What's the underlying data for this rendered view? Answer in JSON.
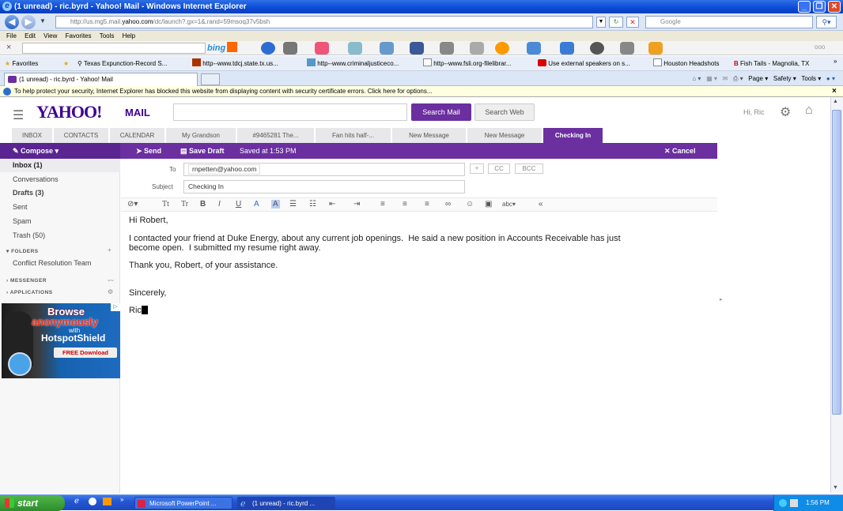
{
  "window": {
    "title": "(1 unread) - ric.byrd - Yahoo! Mail - Windows Internet Explorer"
  },
  "address": {
    "url_prefix": "http://us.mg5.mail.",
    "url_domain": "yahoo.com",
    "url_suffix": "/dc/launch?.gx=1&.rand=59msoq37v5bsh",
    "search_placeholder": "Google"
  },
  "menu": {
    "items": [
      "File",
      "Edit",
      "View",
      "Favorites",
      "Tools",
      "Help"
    ]
  },
  "toolbar2": {
    "close": "×",
    "bing": "bing",
    "dots": "ooo"
  },
  "favorites": {
    "label": "Favorites",
    "items": [
      "Texas Expunction-Record S...",
      "http--www.tdcj.state.tx.us...",
      "http--www.criminaljusticeco...",
      "http--www.fsli.org-filelibrar...",
      "Use external speakers on s...",
      "Houston Headshots",
      "Fish Tails - Magnolia, TX"
    ],
    "more": "»"
  },
  "browser_tab": {
    "label": "(1 unread) - ric.byrd - Yahoo! Mail"
  },
  "commands": {
    "page": "Page ▾",
    "safety": "Safety ▾",
    "tools": "Tools ▾"
  },
  "infobar": {
    "text": "To help protect your security, Internet Explorer has blocked this website from displaying content with security certificate errors. Click here for options...",
    "close": "×"
  },
  "yahoo": {
    "logo": "YAHOO!",
    "mail": "MAIL",
    "search_mail": "Search Mail",
    "search_web": "Search Web",
    "greeting": "Hi, Ric"
  },
  "tabs": [
    "INBOX",
    "CONTACTS",
    "CALENDAR",
    "My Grandson",
    "#9465281 The...",
    "Fan hits half-...",
    "New Message",
    "New Message",
    "Checking In"
  ],
  "compose": {
    "compose_label": "Compose ▾",
    "send": "Send",
    "save_draft": "Save Draft",
    "saved_at": "Saved at 1:53 PM",
    "cancel": "Cancel",
    "to_label": "To",
    "to_value": "rnpetten@yahoo.com",
    "plus": "+",
    "cc": "CC",
    "bcc": "BCC",
    "subject_label": "Subject",
    "subject_value": "Checking In"
  },
  "sidebar": {
    "items": [
      "Inbox (1)",
      "Conversations",
      "Drafts (3)",
      "Sent",
      "Spam",
      "Trash (50)"
    ],
    "folders_label": "FOLDERS",
    "folder_items": [
      "Conflict Resolution Team"
    ],
    "messenger_label": "MESSENGER",
    "applications_label": "APPLICATIONS"
  },
  "ad": {
    "line1": "Browse",
    "line2": "anonymously",
    "line3": "with",
    "line4": "HotspotShield",
    "cta": "FREE Download",
    "tag": "▷"
  },
  "email_body": {
    "greeting": "Hi Robert,",
    "para1": "I contacted your friend at Duke Energy, about any current job openings.  He said a new position in Accounts Receivable has just\nbecome open.  I submitted my resume right away.",
    "para2": "Thank you, Robert, of your assistance.",
    "closing": "Sincerely,",
    "signature": "Ric"
  },
  "taskbar": {
    "start": "start",
    "items": [
      "Microsoft PowerPoint ...",
      "(1 unread) - ric.byrd ..."
    ],
    "time": "1:56 PM"
  }
}
